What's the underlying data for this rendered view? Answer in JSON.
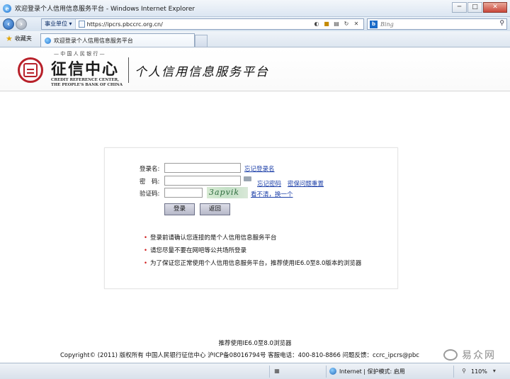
{
  "window": {
    "title": "欢迎登录个人信用信息服务平台 - Windows Internet Explorer",
    "btn_min": "─",
    "btn_max": "□",
    "btn_close": "✕"
  },
  "address": {
    "zone": "事业单位 ▾",
    "url": "https://ipcrs.pbccrc.org.cn/",
    "search_placeholder": "Bing"
  },
  "favorites": {
    "label": "收藏夹",
    "tab_title": "欢迎登录个人信用信息服务平台"
  },
  "header": {
    "bank_line": "— 中 国 人 民 银 行 —",
    "center_name": "征信中心",
    "center_en_1": "CREDIT REFERENCE CENTER,",
    "center_en_2": "THE PEOPLE'S BANK OF CHINA",
    "platform_title": "个人信用信息服务平台"
  },
  "login": {
    "username_label": "登录名:",
    "password_label": "密　码:",
    "captcha_label": "验证码:",
    "username_value": "",
    "password_value": "",
    "captcha_value": "",
    "forgot_username": "忘记登录名",
    "forgot_password": "忘记密码",
    "reset_security": "密保问题重置",
    "captcha_text": "3apvik",
    "refresh_captcha": "看不清，换一个",
    "login_button": "登录",
    "back_button": "返回",
    "notes": [
      "登录前请确认您连接的是个人信用信息服务平台",
      "请您尽量不要在网吧等公共场所登录",
      "为了保证您正常使用个人信用信息服务平台，推荐使用IE6.0至8.0版本的浏览器"
    ]
  },
  "footer": {
    "recommend": "推荐使用IE6.0至8.0浏览器",
    "copyright": "Copyright© (2011) 版权所有 中国人民银行征信中心 沪ICP备08016794号 客服电话：400-810-8866 问题反馈：ccrc_ipcrs@pbc",
    "watermark": "易众网"
  },
  "status": {
    "zone": "Internet | 保护模式: 启用",
    "zoom": "110%"
  },
  "colors": {
    "seal_red": "#b8212a",
    "link_blue": "#1c3fa8",
    "bullet_red": "#d01c1c"
  }
}
